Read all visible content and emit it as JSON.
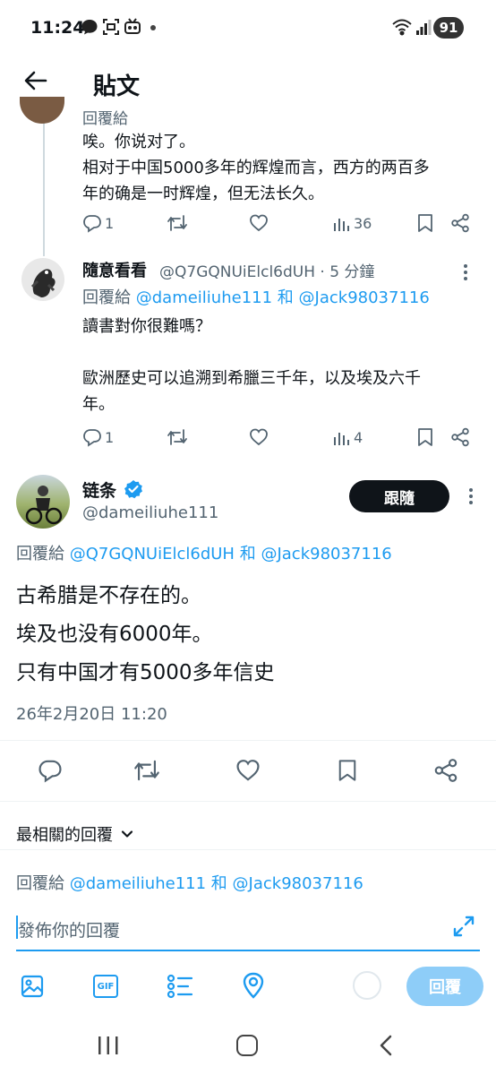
{
  "status_bar": {
    "time": "11:24",
    "battery": "91"
  },
  "header": {
    "title": "貼文"
  },
  "tweet1": {
    "partial_author": "回覆給",
    "lines": [
      "唉。你说对了。",
      "相对于中国5000多年的辉煌而言，西方的两百多",
      "年的确是一时辉煌，但无法长久。"
    ],
    "reply_count": "1",
    "view_count": "36"
  },
  "tweet2": {
    "name": "隨意看看",
    "handle_time": "@Q7GQNUiElcl6dUH · 5 分鐘",
    "reply_to_prefix": "回覆給",
    "reply_to_user1": "@dameiliuhe111",
    "reply_to_and": "和",
    "reply_to_user2": "@Jack98037116",
    "lines": [
      "讀書對你很難嗎？",
      "",
      "歐洲歷史可以追溯到希臘三千年，以及埃及六千",
      "年。"
    ],
    "reply_count": "1",
    "view_count": "4"
  },
  "main_tweet": {
    "name": "链条",
    "handle": "@dameiliuhe111",
    "follow_label": "跟隨",
    "reply_to_prefix": "回覆給",
    "reply_to_user1": "@Q7GQNUiElcl6dUH",
    "reply_to_and": "和",
    "reply_to_user2": "@Jack98037116",
    "lines": [
      "古希腊是不存在的。",
      "埃及也没有6000年。",
      "只有中国才有5000多年信史"
    ],
    "timestamp": "26年2月20日 11:20"
  },
  "sort": {
    "label": "最相關的回覆"
  },
  "composer": {
    "reply_to_prefix": "回覆給",
    "reply_to_user1": "@dameiliuhe111",
    "reply_to_and": "和",
    "reply_to_user2": "@Jack98037116",
    "placeholder": "發佈你的回覆",
    "reply_button": "回覆",
    "gif_label": "GIF"
  },
  "colors": {
    "accent": "#1d9bf0",
    "text": "#0f1419",
    "muted": "#536471",
    "reply_button_disabled": "#8ecdf8"
  }
}
